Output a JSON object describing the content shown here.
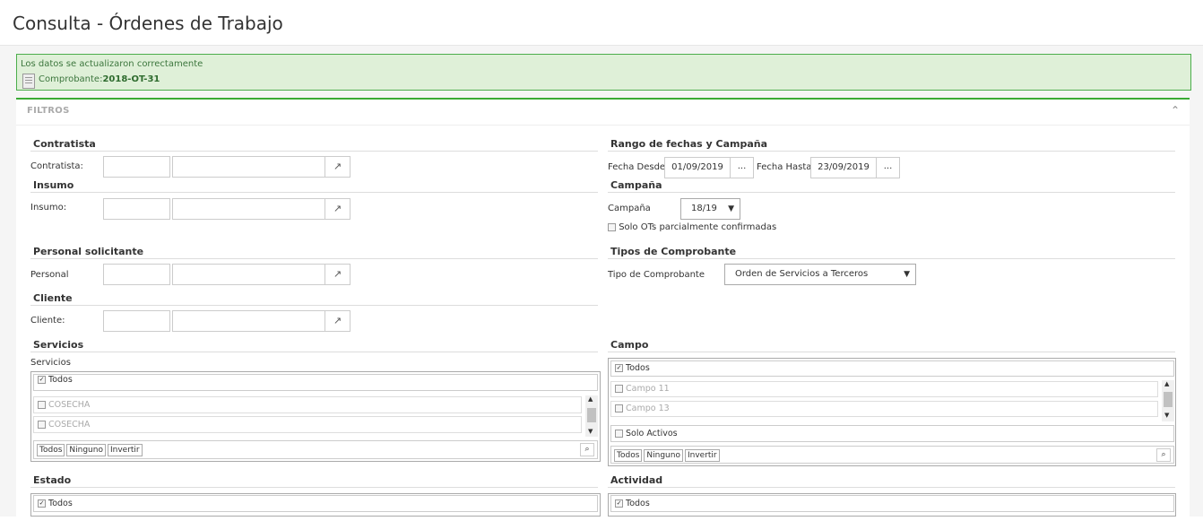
{
  "header": {
    "title": "Consulta - Órdenes de Trabajo"
  },
  "alert": {
    "message": "Los datos se actualizaron correctamente",
    "comprobante_label": "Comprobante:",
    "comprobante_value": "2018-OT-31"
  },
  "panel": {
    "title": "FILTROS"
  },
  "contratista": {
    "section": "Contratista",
    "label": "Contratista:"
  },
  "insumo": {
    "section": "Insumo",
    "label": "Insumo:"
  },
  "personal": {
    "section": "Personal solicitante",
    "label": "Personal"
  },
  "cliente": {
    "section": "Cliente",
    "label": "Cliente:"
  },
  "fechas": {
    "section": "Rango de fechas y Campaña",
    "desde_label": "Fecha Desde",
    "desde_value": "01/09/2019",
    "hasta_label": "Fecha Hasta",
    "hasta_value": "23/09/2019",
    "picker_label": "..."
  },
  "campana": {
    "section": "Campaña",
    "label": "Campaña",
    "value": "18/19",
    "solo_ots_label": "Solo OTs parcialmente confirmadas"
  },
  "tipos": {
    "section": "Tipos de Comprobante",
    "label": "Tipo de Comprobante",
    "value": "Orden de Servicios a Terceros"
  },
  "servicios": {
    "section": "Servicios",
    "label": "Servicios",
    "all_label": "Todos",
    "items": [
      "COSECHA",
      "COSECHA"
    ],
    "btn_todos": "Todos",
    "btn_ninguno": "Ninguno",
    "btn_invertir": "Invertir"
  },
  "campo": {
    "section": "Campo",
    "all_label": "Todos",
    "items": [
      "Campo 11",
      "Campo 13"
    ],
    "solo_activos": "Solo Activos",
    "btn_todos": "Todos",
    "btn_ninguno": "Ninguno",
    "btn_invertir": "Invertir"
  },
  "estado": {
    "section": "Estado",
    "all_label": "Todos"
  },
  "actividad": {
    "section": "Actividad",
    "all_label": "Todos"
  }
}
